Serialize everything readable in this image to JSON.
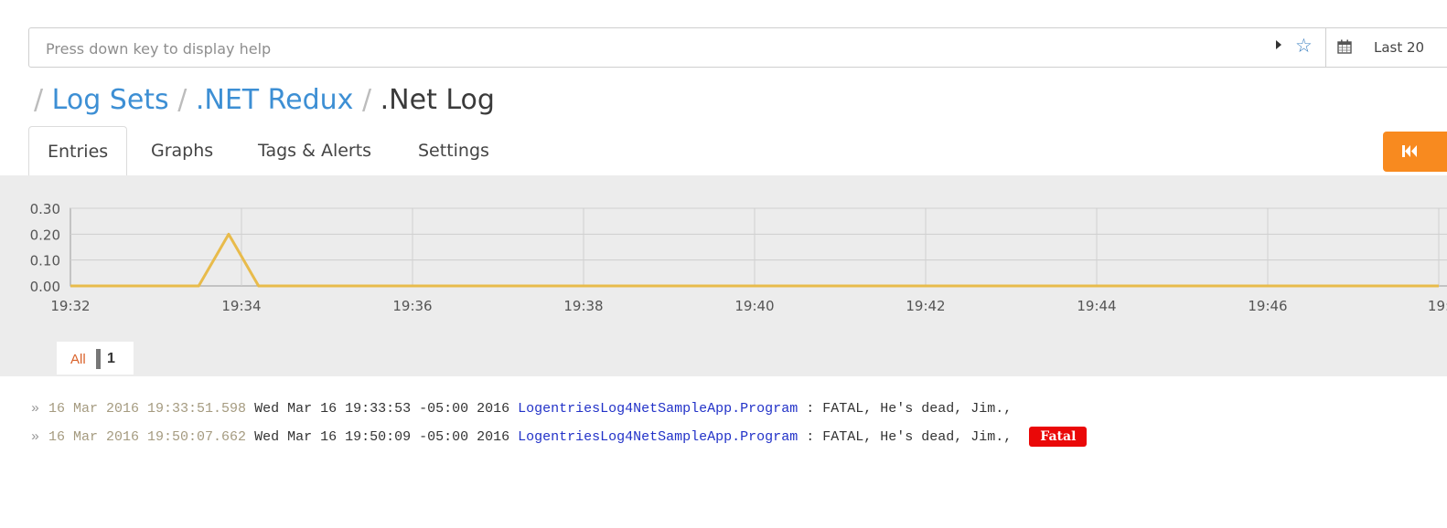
{
  "search": {
    "placeholder": "Press down key to display help"
  },
  "time_range": {
    "label": "Last 20"
  },
  "breadcrumb": {
    "sep": "/",
    "items": [
      {
        "label": "Log Sets"
      },
      {
        "label": ".NET Redux"
      },
      {
        "label": ".Net Log"
      }
    ]
  },
  "tabs": [
    {
      "label": "Entries"
    },
    {
      "label": "Graphs"
    },
    {
      "label": "Tags & Alerts"
    },
    {
      "label": "Settings"
    }
  ],
  "legend": {
    "all_label": "All",
    "count": "1"
  },
  "chart_data": {
    "type": "line",
    "y_ticks": [
      "0.30",
      "0.20",
      "0.10",
      "0.00"
    ],
    "x_ticks": [
      "19:32",
      "19:34",
      "19:36",
      "19:38",
      "19:40",
      "19:42",
      "19:44",
      "19:46",
      "19:"
    ],
    "ylim": [
      0,
      0.3
    ],
    "grid": true,
    "series": [
      {
        "color": "#e8bb4b",
        "points": [
          {
            "x": "19:32",
            "y": 0
          },
          {
            "x": "19:33.5",
            "y": 0
          },
          {
            "x": "19:33.85",
            "y": 0.2
          },
          {
            "x": "19:34.2",
            "y": 0
          },
          {
            "x": "19:48",
            "y": 0
          }
        ]
      }
    ]
  },
  "entries": [
    {
      "timestamp": "16 Mar 2016 19:33:51.598",
      "text": "Wed Mar 16 19:33:53 -05:00 2016",
      "source": "LogentriesLog4NetSampleApp.Program",
      "message": ": FATAL, He's dead, Jim.,",
      "tag": ""
    },
    {
      "timestamp": "16 Mar 2016 19:50:07.662",
      "text": "Wed Mar 16 19:50:09 -05:00 2016",
      "source": "LogentriesLog4NetSampleApp.Program",
      "message": ": FATAL, He's dead, Jim.,",
      "tag": "Fatal"
    }
  ]
}
